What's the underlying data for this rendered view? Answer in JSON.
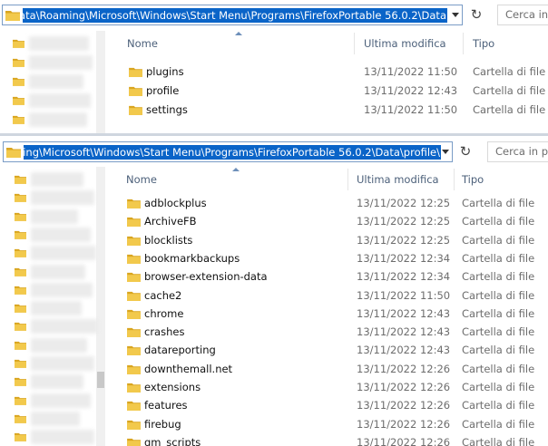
{
  "top_window": {
    "address_path": "ppData\\Roaming\\Microsoft\\Windows\\Start Menu\\Programs\\FirefoxPortable 56.0.2\\Data",
    "search_placeholder": "Cerca in",
    "columns": {
      "name": "Nome",
      "modified": "Ultima modifica",
      "type": "Tipo"
    },
    "rows": [
      {
        "name": "plugins",
        "modified": "13/11/2022 11:50",
        "type": "Cartella di file"
      },
      {
        "name": "profile",
        "modified": "13/11/2022 12:43",
        "type": "Cartella di file"
      },
      {
        "name": "settings",
        "modified": "13/11/2022 11:50",
        "type": "Cartella di file"
      }
    ]
  },
  "bottom_window": {
    "address_path": "\\Roaming\\Microsoft\\Windows\\Start Menu\\Programs\\FirefoxPortable 56.0.2\\Data\\profile",
    "search_placeholder": "Cerca in pro",
    "columns": {
      "name": "Nome",
      "modified": "Ultima modifica",
      "type": "Tipo"
    },
    "rows": [
      {
        "name": "adblockplus",
        "modified": "13/11/2022 12:25",
        "type": "Cartella di file"
      },
      {
        "name": "ArchiveFB",
        "modified": "13/11/2022 12:25",
        "type": "Cartella di file"
      },
      {
        "name": "blocklists",
        "modified": "13/11/2022 12:25",
        "type": "Cartella di file"
      },
      {
        "name": "bookmarkbackups",
        "modified": "13/11/2022 12:34",
        "type": "Cartella di file"
      },
      {
        "name": "browser-extension-data",
        "modified": "13/11/2022 12:34",
        "type": "Cartella di file"
      },
      {
        "name": "cache2",
        "modified": "13/11/2022 11:50",
        "type": "Cartella di file"
      },
      {
        "name": "chrome",
        "modified": "13/11/2022 12:43",
        "type": "Cartella di file"
      },
      {
        "name": "crashes",
        "modified": "13/11/2022 12:43",
        "type": "Cartella di file"
      },
      {
        "name": "datareporting",
        "modified": "13/11/2022 12:43",
        "type": "Cartella di file"
      },
      {
        "name": "downthemall.net",
        "modified": "13/11/2022 12:26",
        "type": "Cartella di file"
      },
      {
        "name": "extensions",
        "modified": "13/11/2022 12:26",
        "type": "Cartella di file"
      },
      {
        "name": "features",
        "modified": "13/11/2022 12:26",
        "type": "Cartella di file"
      },
      {
        "name": "firebug",
        "modified": "13/11/2022 12:26",
        "type": "Cartella di file"
      },
      {
        "name": "gm_scripts",
        "modified": "13/11/2022 12:26",
        "type": "Cartella di file"
      }
    ]
  },
  "icons": {
    "folder": "folder-icon",
    "refresh": "refresh-icon",
    "dropdown": "chevron-down-icon"
  },
  "colors": {
    "selection": "#0a64c8",
    "folder": "#f2c94c",
    "folder_dark": "#d9a520",
    "header_text": "#4c607a",
    "secondary_text": "#6d6d6d"
  }
}
